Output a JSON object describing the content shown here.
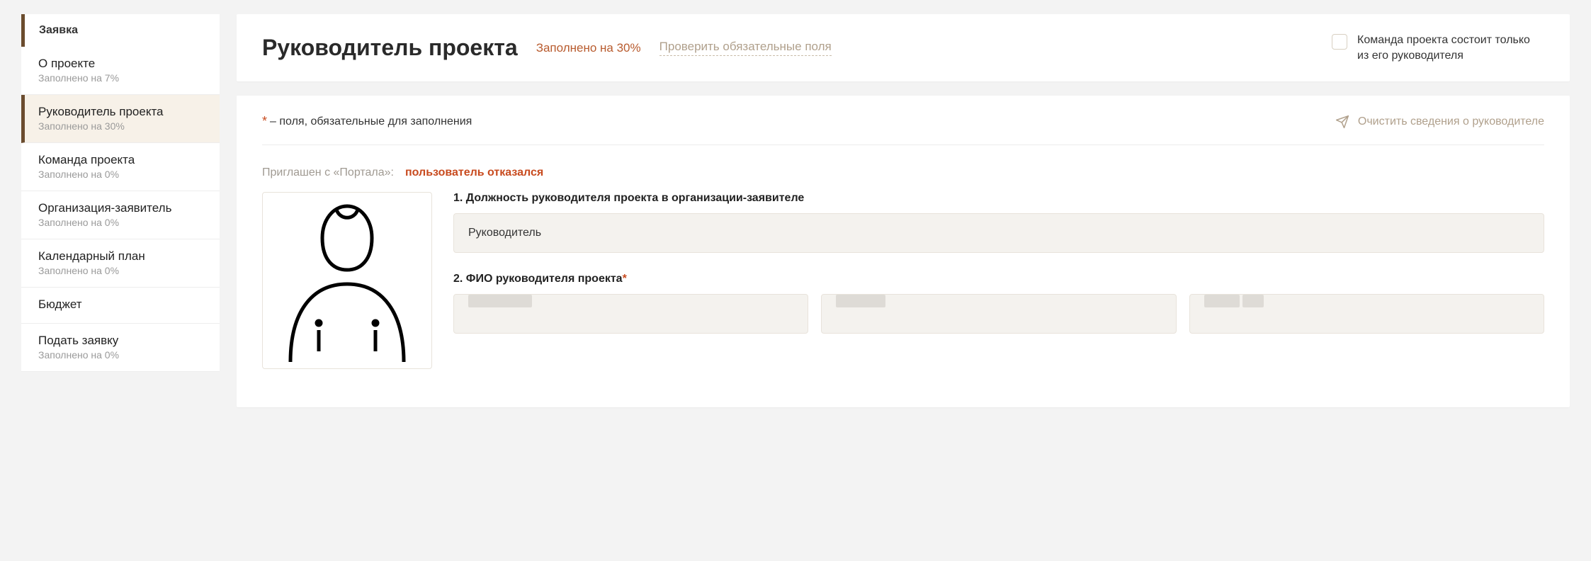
{
  "sidebar": {
    "header": "Заявка",
    "items": [
      {
        "label": "О проекте",
        "sub": "Заполнено на 7%"
      },
      {
        "label": "Руководитель проекта",
        "sub": "Заполнено на 30%"
      },
      {
        "label": "Команда проекта",
        "sub": "Заполнено на 0%"
      },
      {
        "label": "Организация-заявитель",
        "sub": "Заполнено на 0%"
      },
      {
        "label": "Календарный план",
        "sub": "Заполнено на 0%"
      },
      {
        "label": "Бюджет",
        "sub": ""
      },
      {
        "label": "Подать заявку",
        "sub": "Заполнено на 0%"
      }
    ]
  },
  "titleBar": {
    "title": "Руководитель проекта",
    "progress": "Заполнено на 30%",
    "checkRequired": "Проверить обязательные поля",
    "teamCheckbox": "Команда проекта состоит только из его руководителя"
  },
  "form": {
    "requiredHint": "– поля, обязательные для заполнения",
    "clearLink": "Очистить сведения о руководителе",
    "inviteLabel": "Приглашен с «Портала»:",
    "inviteStatus": "пользователь отказался",
    "field1": {
      "label": "1. Должность руководителя проекта в организации-заявителе",
      "value": "Руководитель"
    },
    "field2": {
      "label": "2. ФИО руководителя проекта"
    }
  }
}
